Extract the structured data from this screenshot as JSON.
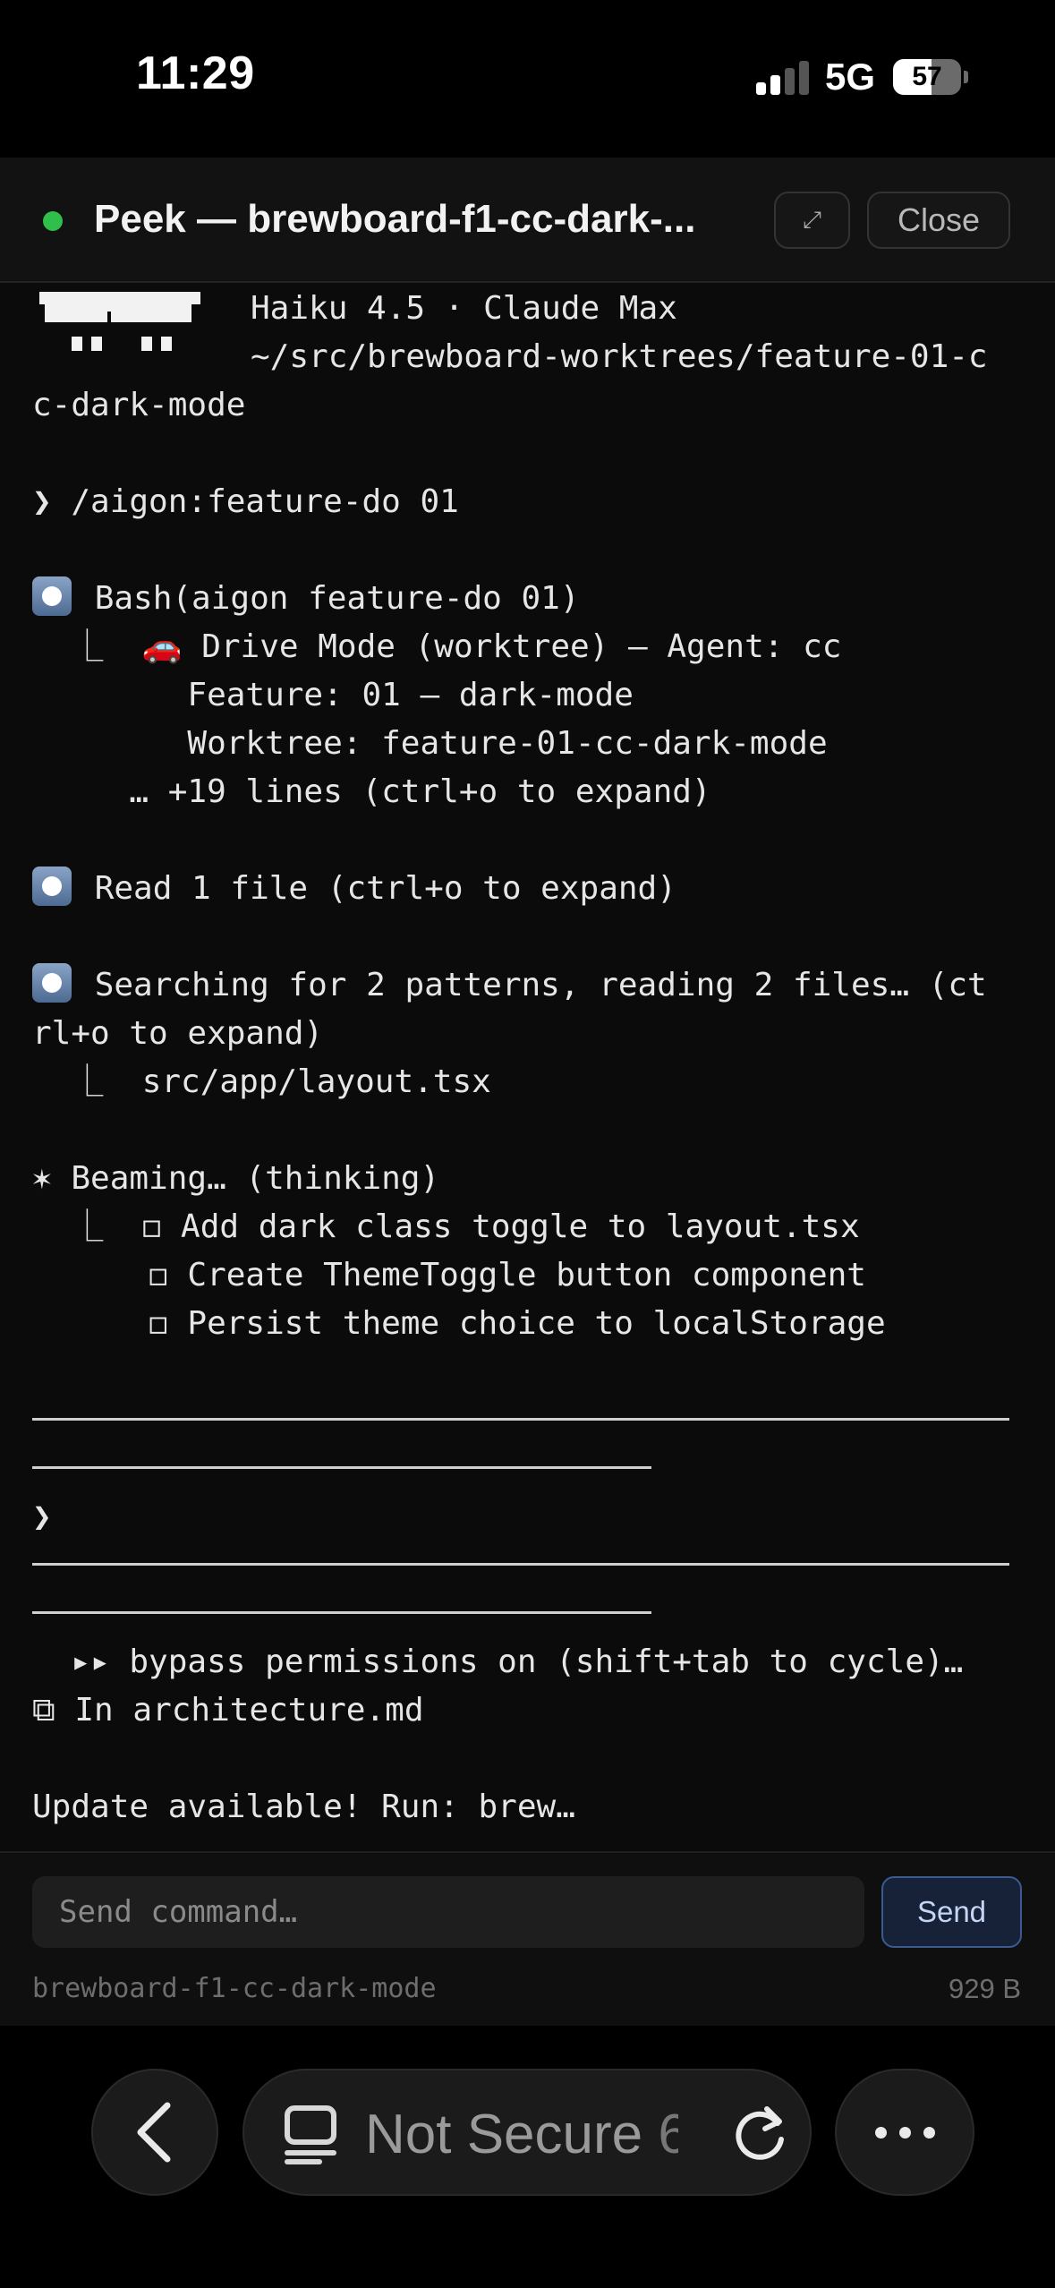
{
  "status_bar": {
    "time": "11:29",
    "network": "5G",
    "battery": "57"
  },
  "header": {
    "title": "Peek — brewboard-f1-cc-dark-...",
    "expand_icon": "⤢",
    "close_label": "Close",
    "live_color": "#2fbf4a"
  },
  "terminal": {
    "model_line": "Haiku 4.5 · Claude Max",
    "path_line1": "~/src/brewboard-worktrees/feature-01-c",
    "path_line2": "c-dark-mode",
    "prompt_cmd": "❯ /aigon:feature-do 01",
    "bash_call": "Bash(aigon feature-do 01)",
    "bash_out1_prefix": "  ⎿  ",
    "bash_out1_icon": "🚗",
    "bash_out1_text": " Drive Mode (worktree) – Agent: cc",
    "bash_out2": "        Feature: 01 – dark-mode",
    "bash_out3": "        Worktree: feature-01-cc-dark-mode",
    "bash_more": "     … +19 lines (ctrl+o to expand)",
    "read_call": "Read 1 file (ctrl+o to expand)",
    "search_call": "Searching for 2 patterns, reading 2 files… (ct",
    "search_wrap": "rl+o to expand)",
    "search_out": "  ⎿  src/app/layout.tsx",
    "beaming": "✶ Beaming… (thinking)",
    "todo1": "  ⎿  ◻ Add dark class toggle to layout.tsx",
    "todo2": "      ◻ Create ThemeToggle button component",
    "todo3": "      ◻ Persist theme choice to localStorage",
    "input_prompt": "❯",
    "permissions": "  ▸▸ bypass permissions on (shift+tab to cycle)…",
    "ide_context": "⧉ In architecture.md",
    "update_notice": "Update available! Run: brew…"
  },
  "command_bar": {
    "placeholder": "Send command…",
    "send_label": "Send",
    "session_name": "brewboard-f1-cc-dark-mode",
    "size": "929 B"
  },
  "browser": {
    "url_text": "Not Secure",
    "url_suffix": "6"
  }
}
